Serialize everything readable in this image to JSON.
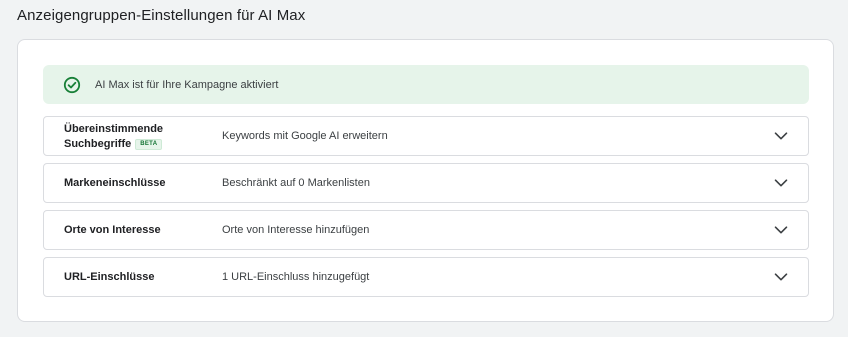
{
  "page": {
    "title": "Anzeigengruppen-Einstellungen für AI Max"
  },
  "banner": {
    "icon": "check-circle-icon",
    "text": "AI Max ist für Ihre Kampagne aktiviert",
    "color": "#188038",
    "background": "#e6f4ea"
  },
  "settings": [
    {
      "label_line1": "Übereinstimmende",
      "label_line2": "Suchbegriffe",
      "badge": "BETA",
      "value": "Keywords mit Google AI erweitern",
      "icon": "chevron-down-icon"
    },
    {
      "label": "Markeneinschlüsse",
      "value": "Beschränkt auf 0 Markenlisten",
      "icon": "chevron-down-icon"
    },
    {
      "label": "Orte von Interesse",
      "value": "Orte von Interesse hinzufügen",
      "icon": "chevron-down-icon"
    },
    {
      "label": "URL-Einschlüsse",
      "value": "1 URL-Einschluss hinzugefügt",
      "icon": "chevron-down-icon"
    }
  ]
}
